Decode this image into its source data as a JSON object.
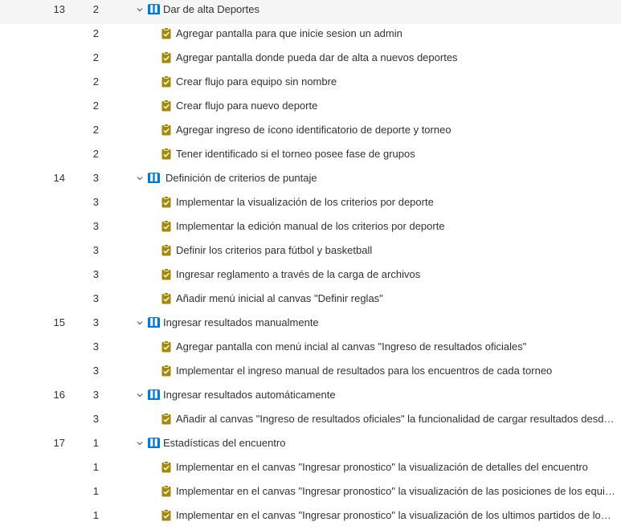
{
  "rows": [
    {
      "type": "story",
      "id": "13",
      "priority": "2",
      "title": "Dar de alta Deportes"
    },
    {
      "type": "task",
      "priority": "2",
      "title": "Agregar pantalla para que inicie sesion un admin"
    },
    {
      "type": "task",
      "priority": "2",
      "title": "Agregar pantalla donde pueda dar de alta a nuevos deportes"
    },
    {
      "type": "task",
      "priority": "2",
      "title": "Crear flujo para equipo sin nombre"
    },
    {
      "type": "task",
      "priority": "2",
      "title": "Crear flujo para nuevo deporte"
    },
    {
      "type": "task",
      "priority": "2",
      "title": "Agregar ingreso de ícono identificatorio de deporte y torneo"
    },
    {
      "type": "task",
      "priority": "2",
      "title": "Tener identificado si el torneo posee fase de grupos"
    },
    {
      "type": "story",
      "id": "14",
      "priority": "3",
      "title": "Definición de criterios de puntaje"
    },
    {
      "type": "task",
      "priority": "3",
      "title": "Implementar la visualización de los criterios por deporte"
    },
    {
      "type": "task",
      "priority": "3",
      "title": "Implementar la edición manual de los criterios por deporte"
    },
    {
      "type": "task",
      "priority": "3",
      "title": "Definir los criterios para fútbol y basketball"
    },
    {
      "type": "task",
      "priority": "3",
      "title": "Ingresar reglamento a través de la carga de archivos"
    },
    {
      "type": "task",
      "priority": "3",
      "title": "Añadir menú inicial al canvas \"Definir reglas\""
    },
    {
      "type": "story",
      "id": "15",
      "priority": "3",
      "title": "Ingresar resultados manualmente"
    },
    {
      "type": "task",
      "priority": "3",
      "title": "Agregar pantalla con menú incial al canvas \"Ingreso de resultados oficiales\""
    },
    {
      "type": "task",
      "priority": "3",
      "title": "Implementar el ingreso manual de resultados para los encuentros de cada torneo"
    },
    {
      "type": "story",
      "id": "16",
      "priority": "3",
      "title": "Ingresar resultados automáticamente"
    },
    {
      "type": "task",
      "priority": "3",
      "title": "Añadir al canvas \"Ingreso de resultados oficiales\" la funcionalidad de cargar resultados desde ..."
    },
    {
      "type": "story",
      "id": "17",
      "priority": "1",
      "title": "Estadísticas del encuentro"
    },
    {
      "type": "task",
      "priority": "1",
      "title": "Implementar en el canvas \"Ingresar pronostico\" la visualización de detalles del encuentro"
    },
    {
      "type": "task",
      "priority": "1",
      "title": "Implementar en el canvas \"Ingresar pronostico\" la visualización de las posiciones de los equip..."
    },
    {
      "type": "task",
      "priority": "1",
      "title": "Implementar en el canvas \"Ingresar pronostico\" la visualización de los ultimos partidos de los ..."
    }
  ],
  "colors": {
    "story_icon": "#0078d4",
    "task_icon": "#a4880a",
    "text": "#323130"
  },
  "icons": {
    "story": "book-icon",
    "task": "clipboard-check-icon",
    "expand": "chevron-down-icon"
  }
}
